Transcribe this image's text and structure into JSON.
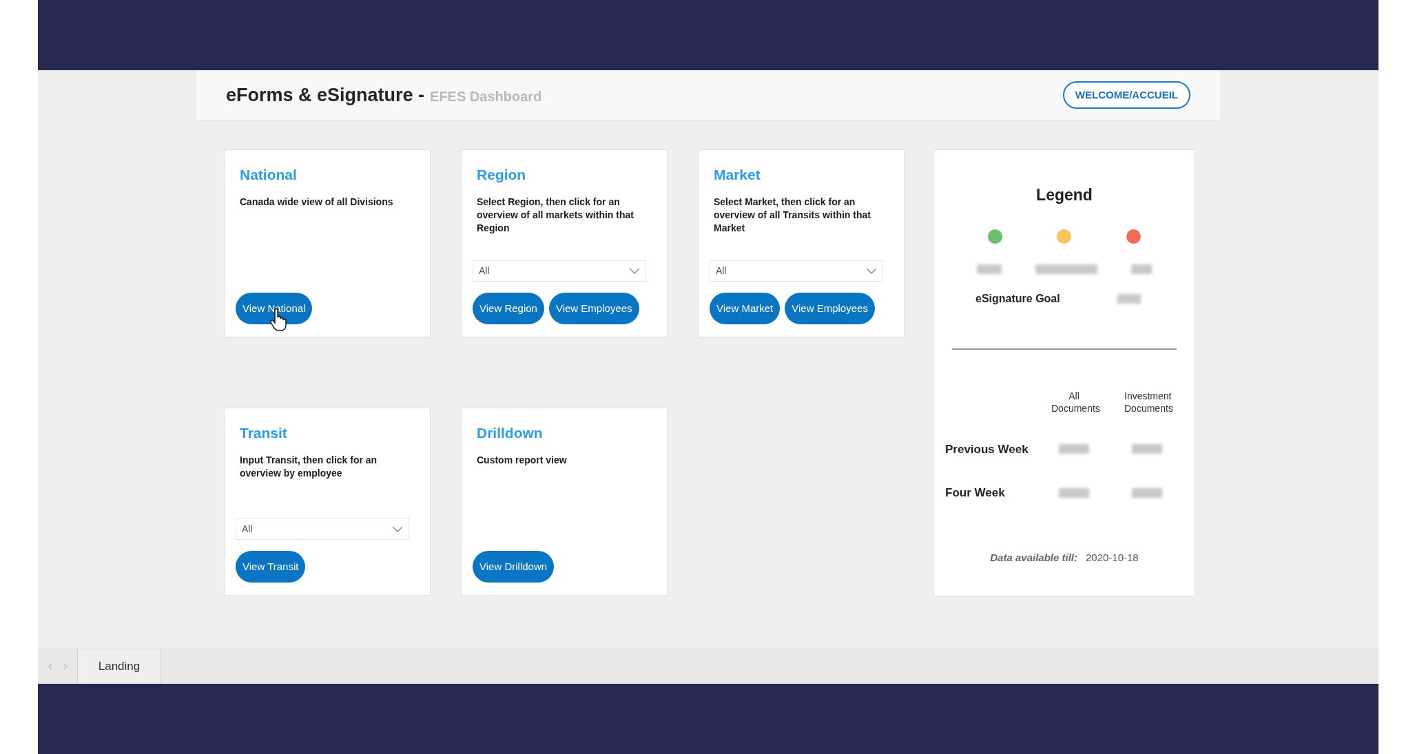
{
  "header": {
    "title": "eForms & eSignature -",
    "subtitle": "EFES Dashboard",
    "button": "WELCOME/ACCUEIL"
  },
  "cards": [
    {
      "kind": "plain",
      "title": "National",
      "description": "Canada wide view of all Divisions",
      "buttons": [
        "View National"
      ]
    },
    {
      "kind": "dropdown",
      "title": "Region",
      "description": "Select Region, then click for an overview of all markets within that Region",
      "dropdown": "All",
      "buttons": [
        "View Region",
        "View Employees"
      ]
    },
    {
      "kind": "dropdown",
      "title": "Market",
      "description": "Select Market, then click for an overview of all Transits within that Market",
      "dropdown": "All",
      "buttons": [
        "View Market",
        "View Employees"
      ]
    },
    {
      "kind": "dropdown",
      "title": "Transit",
      "description": "Input Transit, then click for an overview by employee",
      "dropdown": "All",
      "buttons": [
        "View Transit"
      ]
    },
    {
      "kind": "plain",
      "title": "Drilldown",
      "description": "Custom report view",
      "buttons": [
        "View Drilldown"
      ]
    }
  ],
  "legend": {
    "title": "Legend",
    "dots": [
      {
        "color": "#6cbf6c"
      },
      {
        "color": "#f7c45e"
      },
      {
        "color": "#f26c5a"
      }
    ],
    "goal_label": "eSignature Goal",
    "columns": [
      "All Documents",
      "Investment Documents"
    ],
    "rows": [
      "Previous Week",
      "Four Week"
    ],
    "footer_label": "Data available till:",
    "footer_date": "2020-10-18"
  },
  "tabs": [
    {
      "label": "Landing",
      "selected": true
    }
  ]
}
